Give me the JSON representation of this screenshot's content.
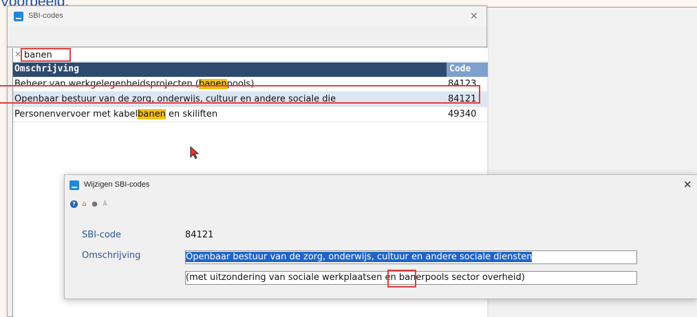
{
  "caption": "Voorbeeld:",
  "sbi_window": {
    "title": "SBI-codes",
    "search": {
      "value": "banen"
    },
    "columns": {
      "omschrijving": "Omschrijving",
      "code": "Code"
    },
    "rows": [
      {
        "desc_pre": "Beheer van werkgelegenheidsprojecten (",
        "desc_hit": "banen",
        "desc_post": "pools)",
        "code": "84123"
      },
      {
        "desc_pre": "Openbaar bestuur van de zorg, onderwijs, cultuur en andere sociale die",
        "desc_hit": "",
        "desc_post": "",
        "code": "84121",
        "selected": true
      },
      {
        "desc_pre": "Personenvervoer met kabel",
        "desc_hit": "banen",
        "desc_post": " en skiliften",
        "code": "49340"
      }
    ]
  },
  "edit_window": {
    "title": "Wijzigen SBI-codes",
    "toolbar_icons": [
      "help-icon",
      "home-icon",
      "record-icon",
      "user-icon"
    ],
    "fields": {
      "sbi_code_label": "SBI-code",
      "sbi_code_value": "84121",
      "omschrijving_label": "Omschrijving",
      "omschrijving_line1": "Openbaar bestuur van de zorg, onderwijs, cultuur en andere sociale diensten",
      "omschrijving_line2_pre": "(met uitzondering van sociale werkplaatsen en ",
      "omschrijving_line2_hit": "baner",
      "omschrijving_line2_post": "pools sector overheid)"
    }
  },
  "colors": {
    "header_bg": "#2e4a6e",
    "code_header_bg": "#7da0cc",
    "highlight": "#f4c112",
    "annotation_red": "#e03b3b",
    "selection_blue": "#1f64c9"
  }
}
